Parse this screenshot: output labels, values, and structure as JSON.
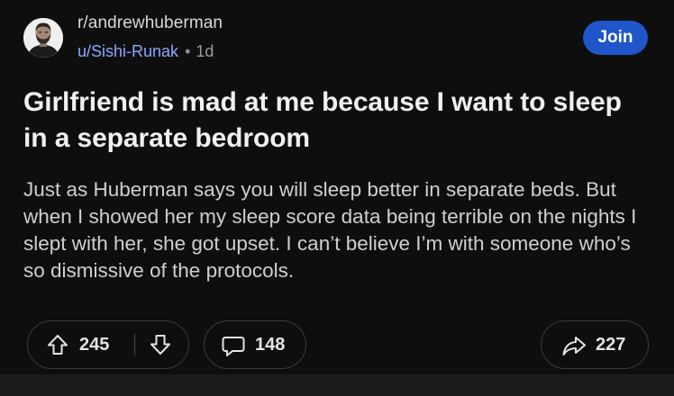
{
  "header": {
    "subreddit": "r/andrewhuberman",
    "username": "u/Sishi-Runak",
    "separator": "•",
    "age": "1d",
    "join_label": "Join"
  },
  "post": {
    "title": "Girlfriend is mad at me because I want to sleep in a separate bedroom",
    "body": "Just as Huberman says you will sleep better in separate beds. But when I showed her my sleep score data being terrible on the nights I slept with her, she got upset. I can’t believe I’m with someone who’s so dismissive of the protocols."
  },
  "actions": {
    "upvotes": "245",
    "comments": "148",
    "shares": "227"
  },
  "colors": {
    "background": "#0e0e0f",
    "username": "#8ea6ff",
    "join_button": "#1f56c9",
    "pill_border": "#3a3a3c"
  },
  "icons": {
    "avatar": "avatar",
    "upvote": "arrow-up-icon",
    "downvote": "arrow-down-icon",
    "comment": "comment-bubble-icon",
    "share": "share-arrow-icon"
  }
}
